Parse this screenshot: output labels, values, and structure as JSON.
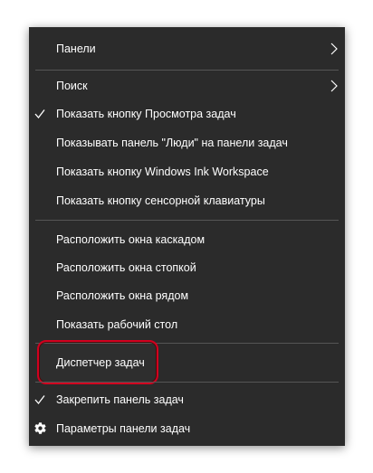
{
  "menu": {
    "items": [
      {
        "label": "Панели",
        "checked": false,
        "submenu": true,
        "icon": "chevron-right-icon"
      },
      {
        "label": "Поиск",
        "checked": false,
        "submenu": true,
        "icon": "chevron-right-icon"
      },
      {
        "label": "Показать кнопку Просмотра задач",
        "checked": true,
        "submenu": false,
        "icon": "checkmark-icon"
      },
      {
        "label": "Показывать панель \"Люди\" на панели задач",
        "checked": false,
        "submenu": false
      },
      {
        "label": "Показать кнопку Windows Ink Workspace",
        "checked": false,
        "submenu": false
      },
      {
        "label": "Показать кнопку сенсорной клавиатуры",
        "checked": false,
        "submenu": false
      },
      {
        "label": "Расположить окна каскадом",
        "checked": false,
        "submenu": false
      },
      {
        "label": "Расположить окна стопкой",
        "checked": false,
        "submenu": false
      },
      {
        "label": "Расположить окна рядом",
        "checked": false,
        "submenu": false
      },
      {
        "label": "Показать рабочий стол",
        "checked": false,
        "submenu": false
      },
      {
        "label": "Диспетчер задач",
        "checked": false,
        "submenu": false,
        "highlighted": true
      },
      {
        "label": "Закрепить панель задач",
        "checked": true,
        "submenu": false,
        "icon": "checkmark-icon"
      },
      {
        "label": "Параметры панели задач",
        "checked": false,
        "submenu": false,
        "icon": "gear-icon"
      }
    ]
  },
  "colors": {
    "menu_background": "#2b2b2b",
    "text": "#ffffff",
    "separator": "#555555",
    "highlight_outline": "#d1001f"
  }
}
